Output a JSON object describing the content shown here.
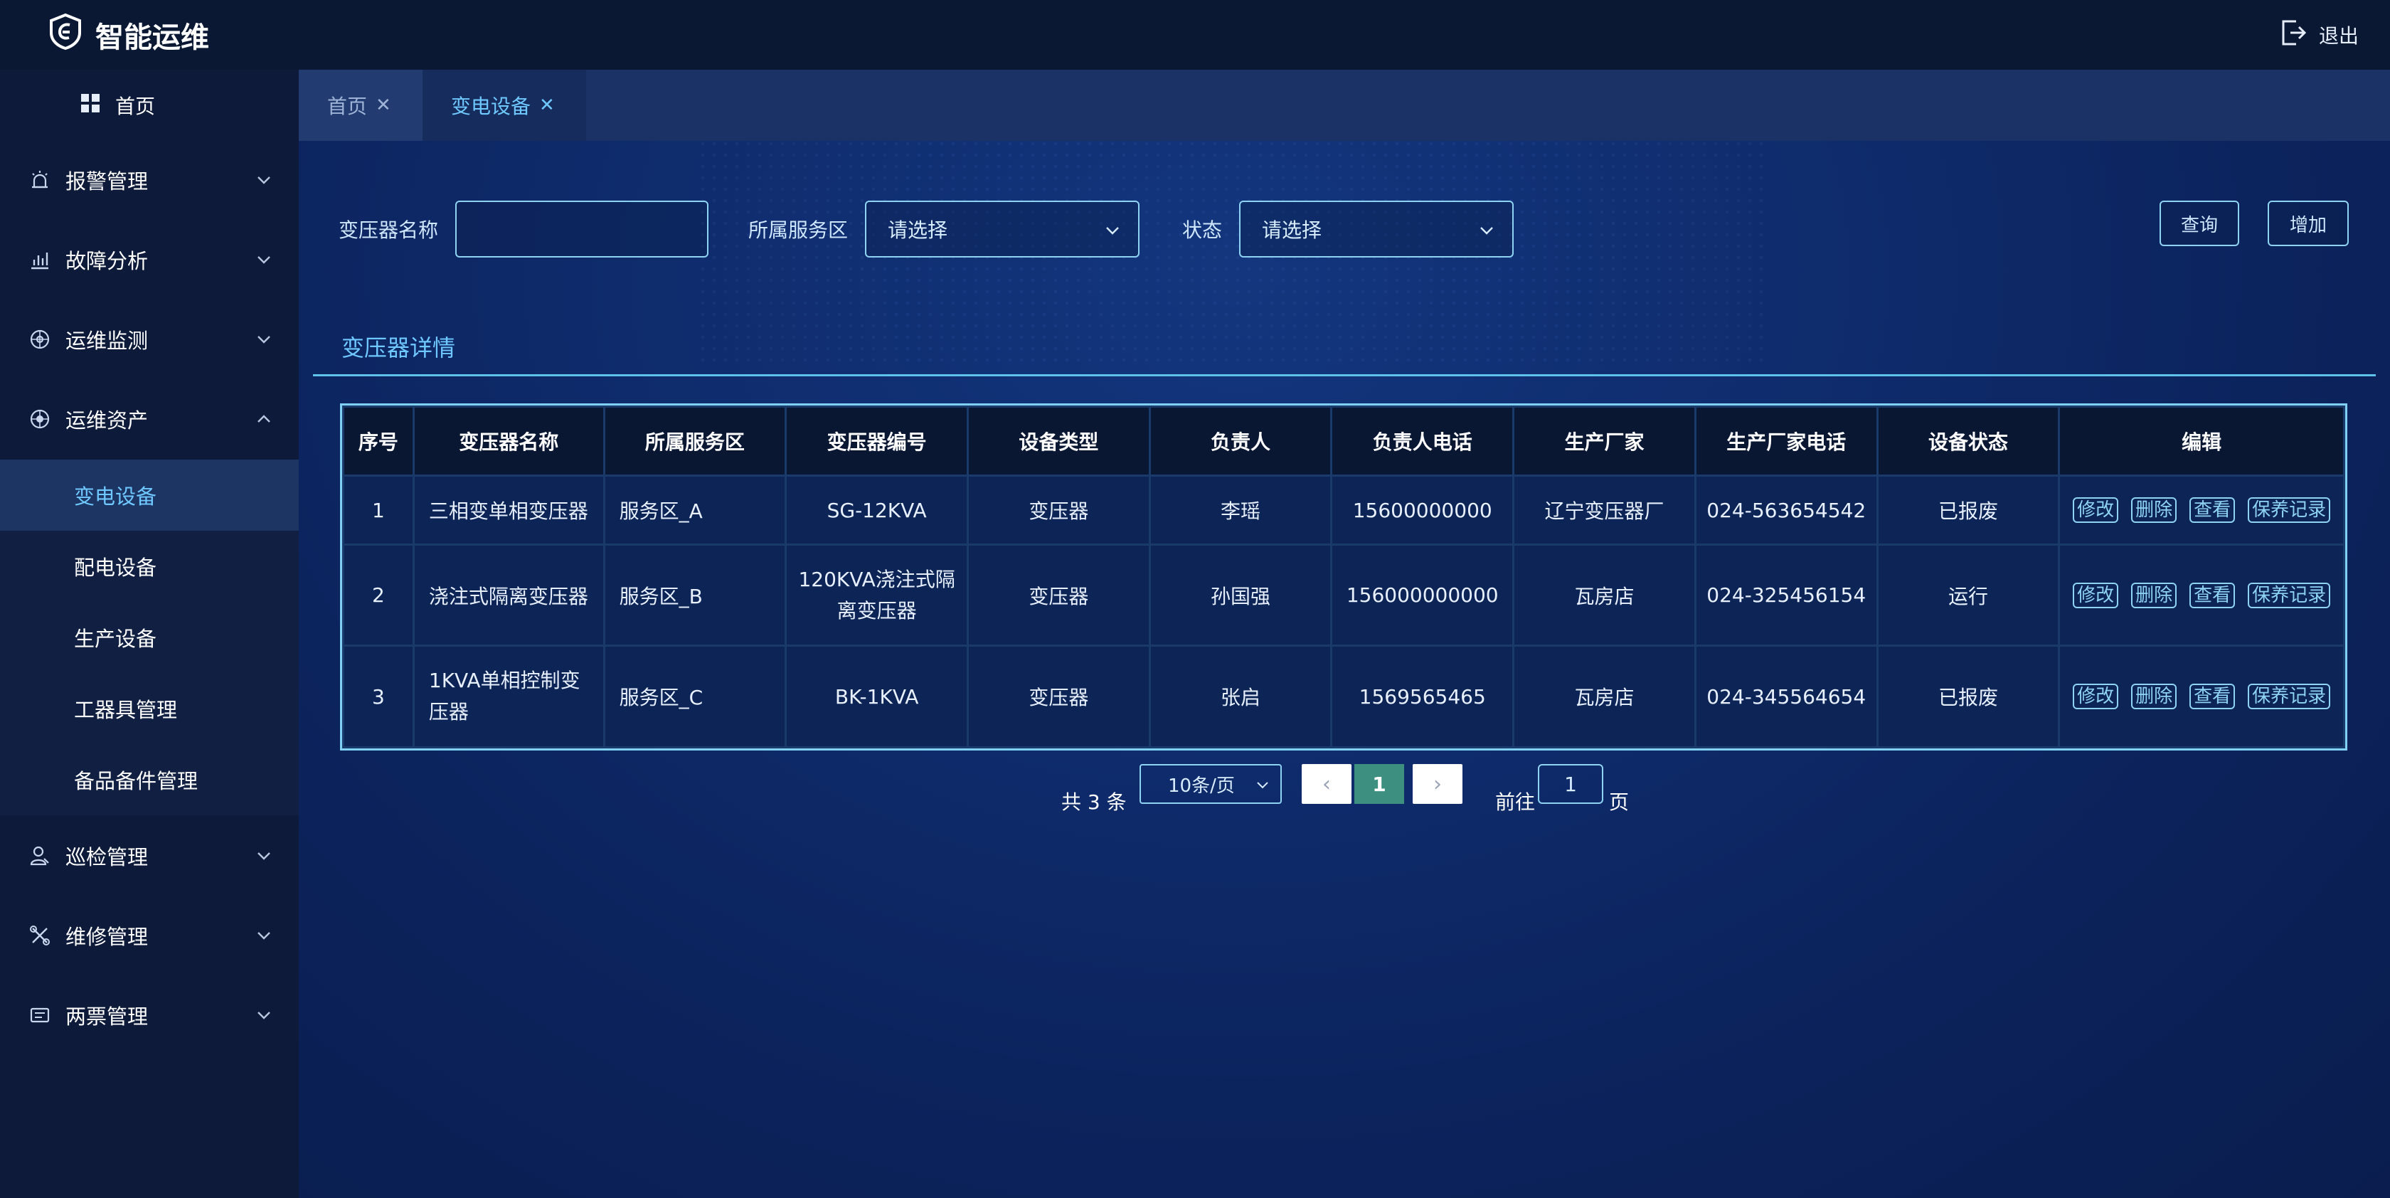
{
  "app": {
    "title": "智能运维",
    "logout_label": "退出"
  },
  "sidebar": {
    "home_label": "首页",
    "menus": [
      {
        "label": "报警管理",
        "icon": "alarm-icon"
      },
      {
        "label": "故障分析",
        "icon": "bar-chart-icon"
      },
      {
        "label": "运维监测",
        "icon": "monitor-icon"
      },
      {
        "label": "运维资产",
        "icon": "asset-icon",
        "expanded": true
      },
      {
        "label": "巡检管理",
        "icon": "inspect-icon"
      },
      {
        "label": "维修管理",
        "icon": "tools-icon"
      },
      {
        "label": "两票管理",
        "icon": "ticket-icon"
      }
    ],
    "submenu": [
      {
        "label": "变电设备",
        "active": true
      },
      {
        "label": "配电设备"
      },
      {
        "label": "生产设备"
      },
      {
        "label": "工器具管理"
      },
      {
        "label": "备品备件管理"
      }
    ]
  },
  "tabs": [
    {
      "label": "首页",
      "active": false
    },
    {
      "label": "变电设备",
      "active": true
    }
  ],
  "filters": {
    "name_label": "变压器名称",
    "name_value": "",
    "area_label": "所属服务区",
    "area_placeholder": "请选择",
    "status_label": "状态",
    "status_placeholder": "请选择",
    "query_label": "查询",
    "add_label": "增加"
  },
  "section_title": "变压器详情",
  "table": {
    "headers": [
      "序号",
      "变压器名称",
      "所属服务区",
      "变压器编号",
      "设备类型",
      "负责人",
      "负责人电话",
      "生产厂家",
      "生产厂家电话",
      "设备状态",
      "编辑"
    ],
    "rows": [
      [
        "1",
        "三相变单相变压器",
        "服务区_A",
        "SG-12KVA",
        "变压器",
        "李瑶",
        "15600000000",
        "辽宁变压器厂",
        "024-563654542",
        "已报废"
      ],
      [
        "2",
        "浇注式隔离变压器",
        "服务区_B",
        "120KVA浇注式隔离变压器",
        "变压器",
        "孙国强",
        "156000000000",
        "瓦房店",
        "024-325456154",
        "运行"
      ],
      [
        "3",
        "1KVA单相控制变压器",
        "服务区_C",
        "BK-1KVA",
        "变压器",
        "张启",
        "1569565465",
        "瓦房店",
        "024-345564654",
        "已报废"
      ]
    ],
    "actions": [
      "修改",
      "删除",
      "查看",
      "保养记录"
    ]
  },
  "pagination": {
    "total_text": "共 3 条",
    "page_size": "10条/页",
    "current_page": "1",
    "goto_label": "前往",
    "goto_value": "1",
    "page_suffix": "页"
  },
  "colors": {
    "accent": "#6fc8ff",
    "border": "#8fd3f2",
    "current_page": "#3d8f80"
  }
}
